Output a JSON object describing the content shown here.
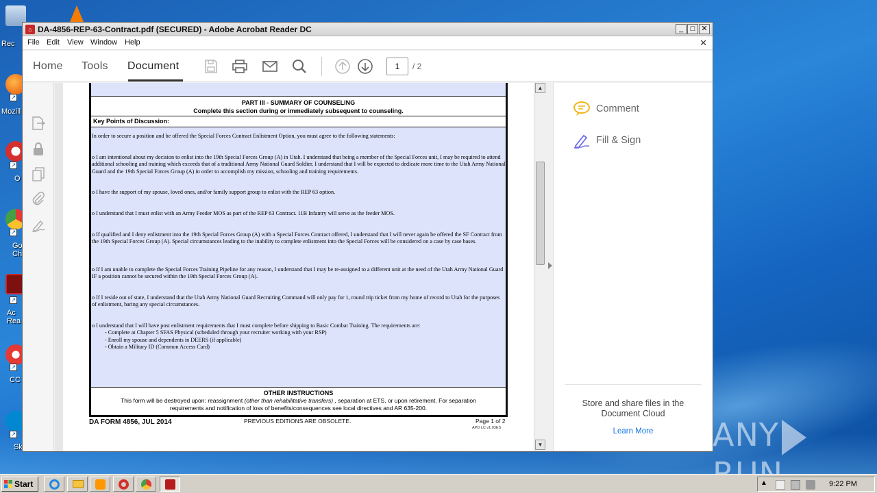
{
  "desktop": {
    "icons": [
      {
        "name": "recycle-bin",
        "label": "Rec",
        "color": "#9fb8d8"
      },
      {
        "name": "vlc",
        "label": "",
        "color": "#f57c00"
      },
      {
        "name": "firefox",
        "label": "Mozill",
        "color": "#e65100"
      },
      {
        "name": "opera",
        "label": "O",
        "color": "#d32f2f"
      },
      {
        "name": "chrome",
        "label": "Go\nCh",
        "color": "#43a047"
      },
      {
        "name": "acrobat",
        "label": "Ac\nRea",
        "color": "#b71c1c"
      },
      {
        "name": "ccleaner",
        "label": "CC",
        "color": "#e53935"
      },
      {
        "name": "skype",
        "label": "Sk",
        "color": "#0288d1"
      }
    ],
    "watermark": {
      "left": "ANY",
      "right": "RUN"
    }
  },
  "window": {
    "title": "DA-4856-REP-63-Contract.pdf (SECURED) - Adobe Acrobat Reader DC",
    "controls": {
      "minimize": "_",
      "maximize": "□",
      "close": "✕"
    },
    "menu": [
      "File",
      "Edit",
      "View",
      "Window",
      "Help"
    ],
    "doc_close": "✕"
  },
  "toolbar": {
    "tabs": [
      "Home",
      "Tools",
      "Document"
    ],
    "active_tab": "Document",
    "icons": [
      "save-icon",
      "print-icon",
      "email-icon",
      "search-icon",
      "page-up-icon",
      "page-down-icon"
    ],
    "page_current": "1",
    "page_total": "/ 2"
  },
  "left_rail": {
    "icons": [
      "export-pdf-icon",
      "lock-icon",
      "copy-pages-icon",
      "attachment-icon",
      "sign-icon"
    ]
  },
  "document": {
    "part3_title": "PART III - SUMMARY OF COUNSELING",
    "part3_subtitle": "Complete this section during or immediately subsequent to counseling.",
    "key_points": "Key Points of Discussion:",
    "paragraphs": [
      "In order to secure a position and be offered the Special Forces Contract Enlistment Option, you must agree to the following statements:",
      "o I am intentional about my decision to enlist into the 19th Special Forces Group (A) in Utah.  I understand that being a member of the Special Forces unit, I may be required to attend additional schooling and training which exceeds that of a traditional Army National Guard Soldier. I  understand that I will be expected to dedicate more time to the Utah Army National Guard and the 19th Special Forces Group (A) in order to accomplish my mission, schooling and training requirements.",
      "o I have the support of my spouse, loved ones, and/or family support group to enlist with the REP 63 option.",
      "o I understand that I must enlist with an Army Feeder MOS as part of the REP 63 Contract.  11B Infantry will serve as the feeder MOS.",
      "o If qualified and I deny enlistment into the 19th Special Forces Group (A) with a Special Forces Contract offered, I understand that I will never again be offered the SF Contract from the 19th Special Forces Group (A). Special circumstances leading to the inability to complete enlistment into the Special Forces will be considered on a case by case bases.",
      "o If I am unable to complete the Special Forces Training Pipeline for any reason, I understand that I may be re-assigned to a different unit at the need of the Utah Army National Guard IF a position cannot be secured within the 19th Special Forces Group (A).",
      "o If I reside out of state, I understand that the Utah Army National Guard Recruiting Command will only pay for 1, round trip ticket from my home of record to Utah for the purposes of enlistment, baring any special circumstances.",
      "o I understand that I will have post enlistment requirements that I must complete before shipping to Basic Combat Training.  The requirements are:"
    ],
    "requirements": [
      "- Complete at Chapter 5 SFAS Physical (scheduled through your recruiter working with your RSP)",
      "- Enroll my spouse and dependents in DEERS (if applicable)",
      "- Obtain a Military ID (Common Access Card)"
    ],
    "other_title": "OTHER INSTRUCTIONS",
    "other_text_1": "This form will be destroyed upon:  reassignment ",
    "other_text_italic": "(other than rehabilitative transfers)",
    "other_text_2": " , separation at ETS, or upon retirement.  For separation",
    "other_text_3": "requirements and notification of loss of benefits/consequences see local directives and AR 635-200.",
    "form_id": "DA FORM 4856, JUL 2014",
    "obsolete": "PREVIOUS EDITIONS ARE OBSOLETE.",
    "page_of": "Page 1 of 2",
    "version": "APD LC v1.03ES"
  },
  "right_pane": {
    "items": [
      {
        "icon": "comment-icon",
        "label": "Comment"
      },
      {
        "icon": "fill-sign-icon",
        "label": "Fill & Sign"
      }
    ],
    "cloud_text": "Store and share files in the Document Cloud",
    "learn_more": "Learn More"
  },
  "taskbar": {
    "start": "Start",
    "time": "9:22 PM"
  },
  "colors": {
    "form_blue": "#dde3fb",
    "accent_link": "#1473e6",
    "comment_icon": "#f2b61b",
    "fill_sign_icon": "#6d6ee8"
  }
}
